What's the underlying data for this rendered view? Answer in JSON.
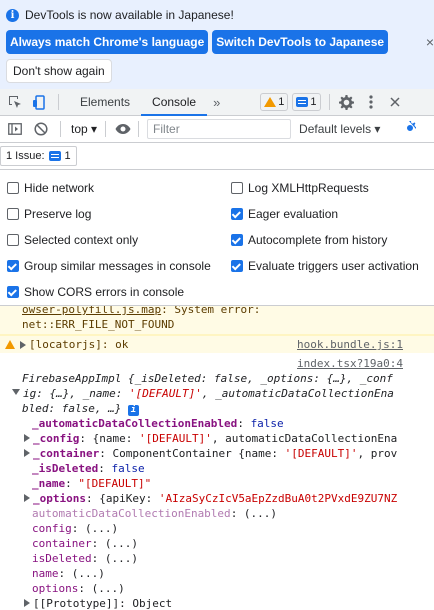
{
  "infobar": {
    "message": "DevTools is now available in Japanese!",
    "btn_match": "Always match Chrome's language",
    "btn_switch": "Switch DevTools to Japanese",
    "btn_dont_show": "Don't show again",
    "close": "×"
  },
  "tabs": {
    "elements": "Elements",
    "console": "Console",
    "more": "»",
    "warn_count": "1",
    "msg_count": "1"
  },
  "toolbar": {
    "context": "top ▾",
    "filter_placeholder": "Filter",
    "levels": "Default levels ▾"
  },
  "issues": {
    "label": "1 Issue:",
    "count": "1"
  },
  "settings": {
    "hide_network": "Hide network",
    "log_xhr": "Log XMLHttpRequests",
    "preserve_log": "Preserve log",
    "eager_eval": "Eager evaluation",
    "selected_ctx": "Selected context only",
    "autocomplete": "Autocomplete from history",
    "group_similar": "Group similar messages in console",
    "eval_triggers": "Evaluate triggers user activation",
    "cors_errors": "Show CORS errors in console",
    "states": {
      "hide_network": false,
      "log_xhr": false,
      "preserve_log": false,
      "eager_eval": true,
      "selected_ctx": false,
      "autocomplete": true,
      "group_similar": true,
      "eval_triggers": true,
      "cors_errors": true
    }
  },
  "console": {
    "err_line1_link": "owser-polyfill.js.map",
    "err_line1_rest": ": System error:",
    "err_line2": "net::ERR_FILE_NOT_FOUND",
    "warn_msg": "[locatorjs]: ok",
    "warn_src": "hook.bundle.js:1",
    "log_src": "index.tsx?19a0:4",
    "obj_l1": "FirebaseAppImpl {_isDeleted: false, _options: {…}, _conf",
    "obj_l2_key": "ig",
    "obj_l2_a": ": {…}, _name: ",
    "obj_l2_str": "'[DEFAULT]'",
    "obj_l2_b": ", _automaticDataCollectionEna",
    "obj_l3": "bled: false, …}",
    "p1_key": "_automaticDataCollectionEnabled",
    "p1_val": "false",
    "p2_key": "_config",
    "p2_val_a": ": {name: ",
    "p2_val_str": "'[DEFAULT]'",
    "p2_val_b": ", automaticDataCollectionEna",
    "p3_key": "_container",
    "p3_val_a": ": ComponentContainer {name: ",
    "p3_val_str": "'[DEFAULT]'",
    "p3_val_b": ", prov",
    "p4_key": "_isDeleted",
    "p4_val": "false",
    "p5_key": "_name",
    "p5_val": "\"[DEFAULT]\"",
    "p6_key": "_options",
    "p6_val_a": ": {apiKey: ",
    "p6_val_str": "'AIzaSyCzIcV5aEpZzdBuA0t2PVxdE9ZU7NZ",
    "g1_key": "automaticDataCollectionEnabled",
    "g1_val": ": (...)",
    "g2_key": "config",
    "g2_val": ": (...)",
    "g3_key": "container",
    "g3_val": ": (...)",
    "g4_key": "isDeleted",
    "g4_val": ": (...)",
    "g5_key": "name",
    "g5_val": ": (...)",
    "g6_key": "options",
    "g6_val": ": (...)",
    "proto_key": "[[Prototype]]",
    "proto_val": ": Object"
  }
}
